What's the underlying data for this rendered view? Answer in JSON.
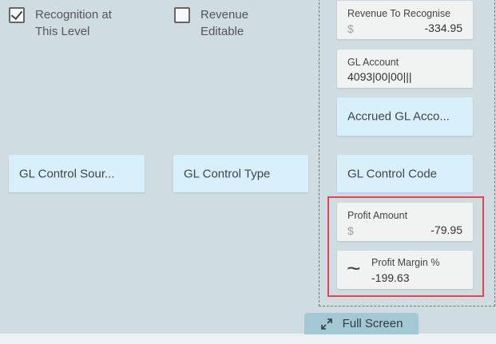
{
  "checkboxes": {
    "recognition": {
      "label": "Recognition at\nThis Level",
      "checked": true
    },
    "revenue_editable": {
      "label": "Revenue\nEditable",
      "checked": false
    }
  },
  "fields": {
    "revenue_to_recognise": {
      "label": "Revenue To Recognise",
      "currency": "$",
      "value": "-334.95"
    },
    "gl_account": {
      "label": "GL Account",
      "value": "4093|00|00|||"
    },
    "accrued_gl_account": {
      "label": "Accrued GL Acco..."
    },
    "gl_control_source": {
      "label": "GL Control Sour..."
    },
    "gl_control_type": {
      "label": "GL Control Type"
    },
    "gl_control_code": {
      "label": "GL Control Code"
    },
    "profit_amount": {
      "label": "Profit Amount",
      "currency": "$",
      "value": "-79.95"
    },
    "profit_margin": {
      "label": "Profit Margin %",
      "value": "-199.63",
      "icon": "approx-icon"
    }
  },
  "footer": {
    "full_screen_label": "Full Screen",
    "icon": "expand-icon"
  },
  "colors": {
    "background": "#cfdde3",
    "field_blue": "#d8f0fb",
    "field_grey": "#f1f2f2",
    "highlight_red": "#e04848",
    "button": "#a4c8d3"
  }
}
